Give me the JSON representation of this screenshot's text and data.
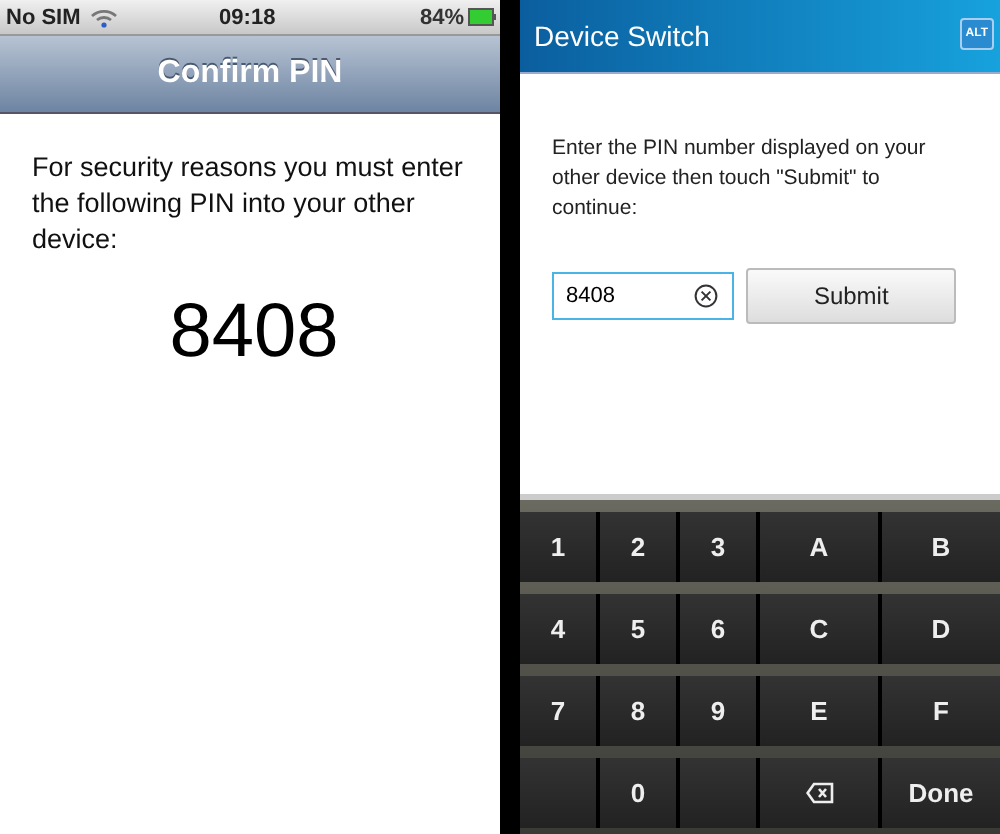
{
  "left_phone": {
    "status_bar": {
      "carrier": "No SIM",
      "time": "09:18",
      "battery": "84%"
    },
    "nav_title": "Confirm PIN",
    "message": "For security reasons you must enter the following PIN into your other device:",
    "pin": "8408"
  },
  "right_phone": {
    "title": "Device Switch",
    "alt_label": "ALT",
    "instructions": "Enter the PIN number displayed on your other device then touch \"Submit\" to continue:",
    "pin_field": {
      "value": "8408"
    },
    "submit_button": "Submit",
    "keyboard": [
      [
        {
          "kind": "char",
          "label": "1"
        },
        {
          "kind": "char",
          "label": "2"
        },
        {
          "kind": "char",
          "label": "3"
        },
        {
          "kind": "char",
          "label": "A"
        },
        {
          "kind": "char",
          "label": "B"
        }
      ],
      [
        {
          "kind": "char",
          "label": "4"
        },
        {
          "kind": "char",
          "label": "5"
        },
        {
          "kind": "char",
          "label": "6"
        },
        {
          "kind": "char",
          "label": "C"
        },
        {
          "kind": "char",
          "label": "D"
        }
      ],
      [
        {
          "kind": "char",
          "label": "7"
        },
        {
          "kind": "char",
          "label": "8"
        },
        {
          "kind": "char",
          "label": "9"
        },
        {
          "kind": "char",
          "label": "E"
        },
        {
          "kind": "char",
          "label": "F"
        }
      ],
      [
        {
          "kind": "blank"
        },
        {
          "kind": "char",
          "label": "0"
        },
        {
          "kind": "blank"
        },
        {
          "kind": "backspace"
        },
        {
          "kind": "char",
          "label": "Done"
        }
      ]
    ]
  }
}
